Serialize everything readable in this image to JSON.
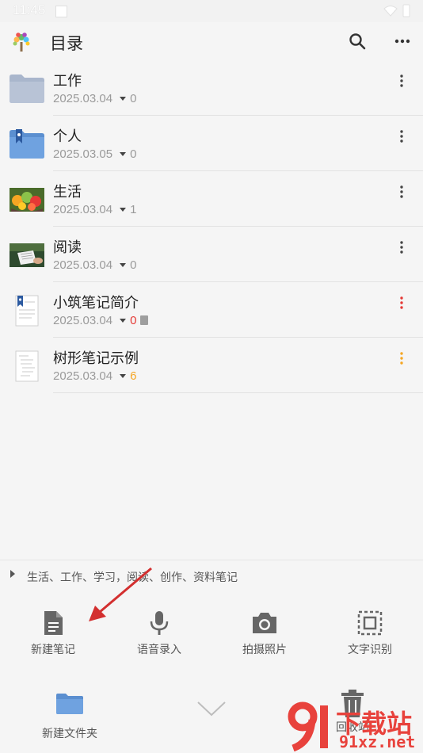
{
  "status_bar": {
    "time": "11:45"
  },
  "header": {
    "title": "目录"
  },
  "items": [
    {
      "name": "工作",
      "date": "2025.03.04",
      "count": "0",
      "count_color": "gray",
      "thumb": "folder-icon",
      "has_doc_icon": false,
      "menu_color": "#444444"
    },
    {
      "name": "个人",
      "date": "2025.03.05",
      "count": "0",
      "count_color": "gray",
      "thumb": "bookmark-folder-icon",
      "has_doc_icon": false,
      "menu_color": "#444444"
    },
    {
      "name": "生活",
      "date": "2025.03.04",
      "count": "1",
      "count_color": "gray",
      "thumb": "fruit-photo",
      "has_doc_icon": false,
      "menu_color": "#444444"
    },
    {
      "name": "阅读",
      "date": "2025.03.04",
      "count": "0",
      "count_color": "gray",
      "thumb": "reading-photo",
      "has_doc_icon": false,
      "menu_color": "#444444"
    },
    {
      "name": "小筑笔记简介",
      "date": "2025.03.04",
      "count": "0",
      "count_color": "red",
      "thumb": "bookmarked-doc-icon",
      "has_doc_icon": true,
      "menu_color": "#e53935"
    },
    {
      "name": "树形笔记示例",
      "date": "2025.03.04",
      "count": "6",
      "count_color": "orange",
      "thumb": "doc-icon",
      "has_doc_icon": false,
      "menu_color": "#f5a623"
    }
  ],
  "tags_bar": {
    "text": "生活、工作、学习，阅读、创作、资料笔记"
  },
  "actions": [
    {
      "label": "新建笔记",
      "icon": "note-icon"
    },
    {
      "label": "语音录入",
      "icon": "mic-icon"
    },
    {
      "label": "拍摄照片",
      "icon": "camera-icon"
    },
    {
      "label": "文字识别",
      "icon": "text-recognition-icon"
    }
  ],
  "bottom": {
    "new_folder_label": "新建文件夹",
    "trash_label": "回收站"
  },
  "watermark": {
    "text": "下载站",
    "url": "91xz.net"
  },
  "colors": {
    "accent": "#f5a623",
    "danger": "#e53935",
    "folder": "#6a9fd6"
  }
}
